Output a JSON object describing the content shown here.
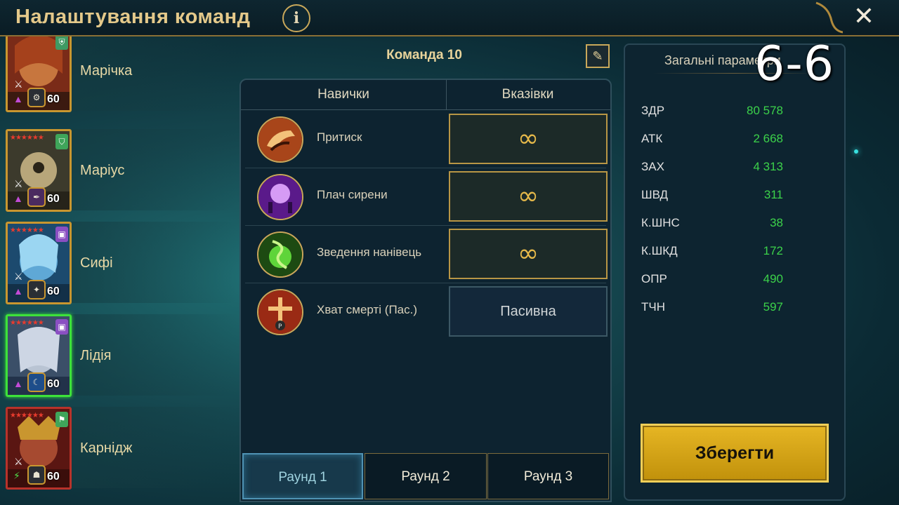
{
  "header": {
    "title": "Налаштування команд",
    "info_icon": "i",
    "close_icon": "✕"
  },
  "team": {
    "name": "Команда 10"
  },
  "columns": {
    "skills": "Навички",
    "preferences": "Вказівки"
  },
  "skills": [
    {
      "name": "Притиск",
      "preference": "∞",
      "icon": "fist-skill-icon"
    },
    {
      "name": "Плач сирени",
      "preference": "∞",
      "icon": "siren-skill-icon"
    },
    {
      "name": "Зведення нанівець",
      "preference": "∞",
      "icon": "poison-skill-icon"
    },
    {
      "name": "Хват смерті (Пас.)",
      "preference": "Пасивна",
      "icon": "death-grip-skill-icon"
    }
  ],
  "rounds": [
    "Раунд 1",
    "Раунд 2",
    "Раунд 3"
  ],
  "active_round": 0,
  "champions": [
    {
      "name": "Марічка",
      "level": "60",
      "stars": "",
      "selected": false
    },
    {
      "name": "Маріус",
      "level": "60",
      "stars": "★★★★★★",
      "selected": false
    },
    {
      "name": "Сифі",
      "level": "60",
      "stars": "★★★★★★",
      "selected": false
    },
    {
      "name": "Лідія",
      "level": "60",
      "stars": "★★★★★★",
      "selected": true
    },
    {
      "name": "Карнідж",
      "level": "60",
      "stars": "★★★★★★",
      "selected": false
    }
  ],
  "stats_panel": {
    "title": "Загальні параметри",
    "overlay": "6-6",
    "stats": [
      {
        "label": "ЗДР",
        "value": "80 578"
      },
      {
        "label": "АТК",
        "value": "2 668"
      },
      {
        "label": "ЗАХ",
        "value": "4 313"
      },
      {
        "label": "ШВД",
        "value": "311"
      },
      {
        "label": "К.ШНС",
        "value": "38"
      },
      {
        "label": "К.ШКД",
        "value": "172"
      },
      {
        "label": "ОПР",
        "value": "490"
      },
      {
        "label": "ТЧН",
        "value": "597"
      }
    ]
  },
  "save_label": "Зберегти",
  "colors": {
    "gold": "#c9962f",
    "stat_green": "#3cd24a",
    "selected_green": "#3de23a"
  }
}
